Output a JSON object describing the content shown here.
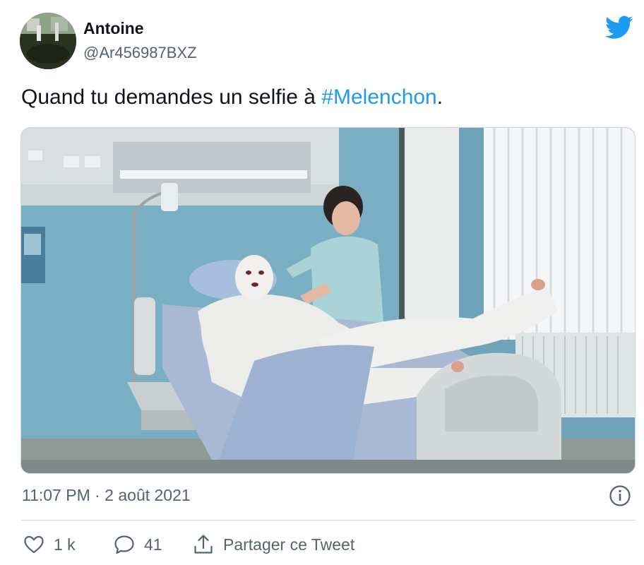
{
  "author": {
    "display_name": "Antoine",
    "handle": "@Ar456987BXZ"
  },
  "tweet": {
    "text_before": "Quand tu demandes un selfie à ",
    "hashtag": "#Melenchon",
    "text_after": "."
  },
  "meta": {
    "timestamp": "11:07 PM · 2 août 2021"
  },
  "actions": {
    "likes": "1 k",
    "replies": "41",
    "share_label": "Partager ce Tweet"
  },
  "icons": {
    "brand": "twitter-bird-icon",
    "info": "info-icon",
    "like": "heart-icon",
    "reply": "reply-bubble-icon",
    "share": "share-upload-icon"
  },
  "colors": {
    "accent": "#1d9bf0",
    "text": "#0f1419",
    "secondary": "#536471",
    "border": "#cfd9de"
  }
}
